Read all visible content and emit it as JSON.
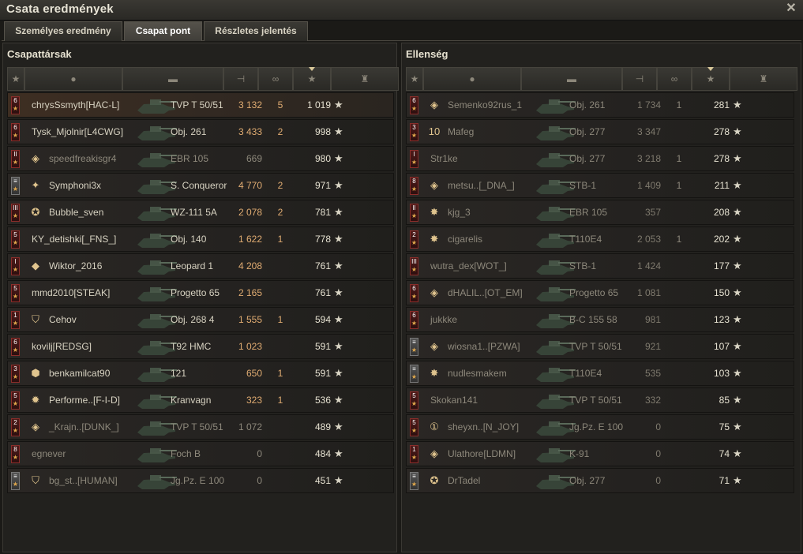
{
  "window": {
    "title": "Csata eredmények",
    "close_icon": "close-icon"
  },
  "tabs": [
    {
      "label": "Személyes eredmény",
      "active": false
    },
    {
      "label": "Csapat pont",
      "active": true
    },
    {
      "label": "Részletes jelentés",
      "active": false
    }
  ],
  "columns": [
    "rank-icon",
    "player-icon",
    "tank-icon",
    "damage-icon",
    "kills-icon",
    "score-star-icon",
    "medal-icon"
  ],
  "allies": {
    "title": "Csapattársak",
    "rows": [
      {
        "badge": "6",
        "mark": "",
        "name": "chrysSsmyth[HAC-L]",
        "tank": "TVP T 50/51",
        "damage": "3 132",
        "kills": "5",
        "score": "1 019",
        "dead": false,
        "player": true
      },
      {
        "badge": "6",
        "mark": "",
        "name": "Tysk_Mjolnir[L4CWG]",
        "tank": "Obj. 261",
        "damage": "3 433",
        "kills": "2",
        "score": "998",
        "dead": false,
        "player": false
      },
      {
        "badge": "II",
        "mark": "◈",
        "name": "speedfreakisgr4",
        "tank": "EBR 105",
        "damage": "669",
        "kills": "",
        "score": "980",
        "dead": true,
        "player": false
      },
      {
        "badge": "≡",
        "mark": "✦",
        "name": "Symphoni3x",
        "tank": "S. Conqueror",
        "damage": "4 770",
        "kills": "2",
        "score": "971",
        "dead": false,
        "player": false
      },
      {
        "badge": "III",
        "mark": "✪",
        "name": "Bubble_sven",
        "tank": "WZ-111 5A",
        "damage": "2 078",
        "kills": "2",
        "score": "781",
        "dead": false,
        "player": false
      },
      {
        "badge": "5",
        "mark": "",
        "name": "KY_detishki[_FNS_]",
        "tank": "Obj. 140",
        "damage": "1 622",
        "kills": "1",
        "score": "778",
        "dead": false,
        "player": false
      },
      {
        "badge": "I",
        "mark": "◆",
        "name": "Wiktor_2016",
        "tank": "Leopard 1",
        "damage": "4 208",
        "kills": "",
        "score": "761",
        "dead": false,
        "player": false
      },
      {
        "badge": "5",
        "mark": "",
        "name": "mmd2010[STEAK]",
        "tank": "Progetto 65",
        "damage": "2 165",
        "kills": "",
        "score": "761",
        "dead": false,
        "player": false
      },
      {
        "badge": "1",
        "mark": "⛉",
        "name": "Cehov",
        "tank": "Obj. 268 4",
        "damage": "1 555",
        "kills": "1",
        "score": "594",
        "dead": false,
        "player": false
      },
      {
        "badge": "6",
        "mark": "",
        "name": "kovilj[REDSG]",
        "tank": "T92 HMC",
        "damage": "1 023",
        "kills": "",
        "score": "591",
        "dead": false,
        "player": false
      },
      {
        "badge": "3",
        "mark": "⬢",
        "name": "benkamilcat90",
        "tank": "121",
        "damage": "650",
        "kills": "1",
        "score": "591",
        "dead": false,
        "player": false
      },
      {
        "badge": "5",
        "mark": "✹",
        "name": "Performe..[F-I-D]",
        "tank": "Kranvagn",
        "damage": "323",
        "kills": "1",
        "score": "536",
        "dead": false,
        "player": false
      },
      {
        "badge": "2",
        "mark": "◈",
        "name": "_Krajn..[DUNK_]",
        "tank": "TVP T 50/51",
        "damage": "1 072",
        "kills": "",
        "score": "489",
        "dead": true,
        "player": false
      },
      {
        "badge": "8",
        "mark": "",
        "name": "egnever",
        "tank": "Foch B",
        "damage": "0",
        "kills": "",
        "score": "484",
        "dead": true,
        "player": false
      },
      {
        "badge": "≡",
        "mark": "⛉",
        "name": "bg_st..[HUMAN]",
        "tank": "Jg.Pz. E 100",
        "damage": "0",
        "kills": "",
        "score": "451",
        "dead": true,
        "player": false
      }
    ]
  },
  "enemies": {
    "title": "Ellenség",
    "rows": [
      {
        "badge": "6",
        "mark": "◈",
        "name": "Semenko92rus_1",
        "tank": "Obj. 261",
        "damage": "1 734",
        "kills": "1",
        "score": "281",
        "dead": true
      },
      {
        "badge": "3",
        "mark": "10",
        "name": "Mafeg",
        "tank": "Obj. 277",
        "damage": "3 347",
        "kills": "",
        "score": "278",
        "dead": true
      },
      {
        "badge": "I",
        "mark": "",
        "name": "Str1ke",
        "tank": "Obj. 277",
        "damage": "3 218",
        "kills": "1",
        "score": "278",
        "dead": true
      },
      {
        "badge": "8",
        "mark": "◈",
        "name": "metsu..[_DNA_]",
        "tank": "STB-1",
        "damage": "1 409",
        "kills": "1",
        "score": "211",
        "dead": true
      },
      {
        "badge": "II",
        "mark": "✸",
        "name": "kjg_3",
        "tank": "EBR 105",
        "damage": "357",
        "kills": "",
        "score": "208",
        "dead": true
      },
      {
        "badge": "2",
        "mark": "✸",
        "name": "cigarelis",
        "tank": "T110E4",
        "damage": "2 053",
        "kills": "1",
        "score": "202",
        "dead": true
      },
      {
        "badge": "III",
        "mark": "",
        "name": "wutra_dex[WOT_]",
        "tank": "STB-1",
        "damage": "1 424",
        "kills": "",
        "score": "177",
        "dead": true
      },
      {
        "badge": "6",
        "mark": "◈",
        "name": "dHALIL..[OT_EM]",
        "tank": "Progetto 65",
        "damage": "1 081",
        "kills": "",
        "score": "150",
        "dead": true
      },
      {
        "badge": "6",
        "mark": "",
        "name": "jukkke",
        "tank": "B-C 155 58",
        "damage": "981",
        "kills": "",
        "score": "123",
        "dead": true
      },
      {
        "badge": "≡",
        "mark": "◈",
        "name": "wiosna1..[PZWA]",
        "tank": "TVP T 50/51",
        "damage": "921",
        "kills": "",
        "score": "107",
        "dead": true
      },
      {
        "badge": "≡",
        "mark": "✸",
        "name": "nudlesmakem",
        "tank": "T110E4",
        "damage": "535",
        "kills": "",
        "score": "103",
        "dead": true
      },
      {
        "badge": "5",
        "mark": "",
        "name": "Skokan141",
        "tank": "TVP T 50/51",
        "damage": "332",
        "kills": "",
        "score": "85",
        "dead": true
      },
      {
        "badge": "5",
        "mark": "①",
        "name": "sheyxn..[N_JOY]",
        "tank": "Jg.Pz. E 100",
        "damage": "0",
        "kills": "",
        "score": "75",
        "dead": true
      },
      {
        "badge": "1",
        "mark": "◈",
        "name": "Ulathore[LDMN]",
        "tank": "K-91",
        "damage": "0",
        "kills": "",
        "score": "74",
        "dead": true
      },
      {
        "badge": "≡",
        "mark": "✪",
        "name": "DrTadel",
        "tank": "Obj. 277",
        "damage": "0",
        "kills": "",
        "score": "71",
        "dead": true
      }
    ]
  }
}
